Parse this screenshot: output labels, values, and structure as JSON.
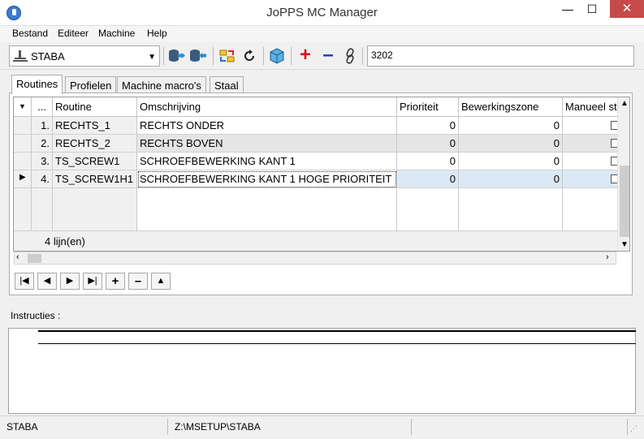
{
  "window": {
    "title": "JoPPS MC Manager",
    "close": "✕",
    "maximize": "☐",
    "minimize": "—"
  },
  "menu": {
    "items": [
      "Bestand",
      "Editeer",
      "Machine",
      "Help"
    ]
  },
  "toolbar": {
    "machine_value": "STABA",
    "search_value": "3202"
  },
  "tabs": [
    "Routines",
    "Profielen",
    "Machine macro's",
    "Staal"
  ],
  "grid": {
    "columns": [
      "...",
      "Routine",
      "Omschrijving",
      "Prioriteit",
      "Bewerkingszone",
      "Manueel st"
    ],
    "rows": [
      {
        "n": "1.",
        "routine": "RECHTS_1",
        "desc": "RECHTS ONDER",
        "prio": "0",
        "zone": "0"
      },
      {
        "n": "2.",
        "routine": "RECHTS_2",
        "desc": "RECHTS BOVEN",
        "prio": "0",
        "zone": "0"
      },
      {
        "n": "3.",
        "routine": "TS_SCREW1",
        "desc": "SCHROEFBEWERKING KANT 1",
        "prio": "0",
        "zone": "0"
      },
      {
        "n": "4.",
        "routine": "TS_SCREW1H1",
        "desc": "SCHROEFBEWERKING KANT 1 HOGE PRIORITEIT",
        "prio": "0",
        "zone": "0"
      }
    ],
    "count_label": "4 lijn(en)"
  },
  "instructions": {
    "label": "Instructies :"
  },
  "status": {
    "machine": "STABA",
    "path": "Z:\\MSETUP\\STABA"
  }
}
